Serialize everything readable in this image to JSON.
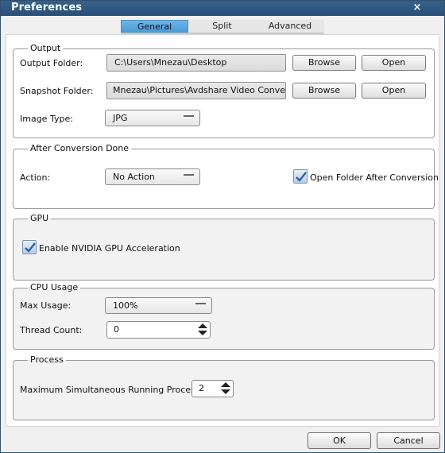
{
  "window": {
    "title": "Preferences",
    "close_glyph": "×"
  },
  "tabs": [
    {
      "label": "General",
      "active": true
    },
    {
      "label": "Split",
      "active": false
    },
    {
      "label": "Advanced",
      "active": false
    }
  ],
  "output": {
    "legend": "Output",
    "output_folder_label": "Output Folder:",
    "output_folder_value": "C:\\Users\\Mnezau\\Desktop",
    "snapshot_folder_label": "Snapshot Folder:",
    "snapshot_folder_value": "Mnezau\\Pictures\\Avdshare Video Converter",
    "image_type_label": "Image Type:",
    "image_type_value": "JPG",
    "browse_label": "Browse",
    "open_label": "Open"
  },
  "after_conversion": {
    "legend": "After Conversion Done",
    "action_label": "Action:",
    "action_value": "No Action",
    "open_folder_label": "Open Folder After Conversion",
    "open_folder_checked": true
  },
  "gpu": {
    "legend": "GPU",
    "nvidia_label": "Enable NVIDIA GPU Acceleration",
    "nvidia_checked": true
  },
  "cpu": {
    "legend": "CPU Usage",
    "max_usage_label": "Max Usage:",
    "max_usage_value": "100%",
    "thread_count_label": "Thread Count:",
    "thread_count_value": "0"
  },
  "process": {
    "legend": "Process",
    "max_processes_label": "Maximum Simultaneous Running Processes:",
    "max_processes_value": "2"
  },
  "footer": {
    "ok_label": "OK",
    "cancel_label": "Cancel"
  },
  "colors": {
    "titlebar": "#2f5a85",
    "tab_active": "#5aa9e0",
    "check": "#2b5fa8"
  },
  "icons": {
    "close": "close-icon",
    "check": "checkmark-icon",
    "dropdown": "chevron-down-icon",
    "spin_up": "spin-up-icon",
    "spin_down": "spin-down-icon"
  }
}
